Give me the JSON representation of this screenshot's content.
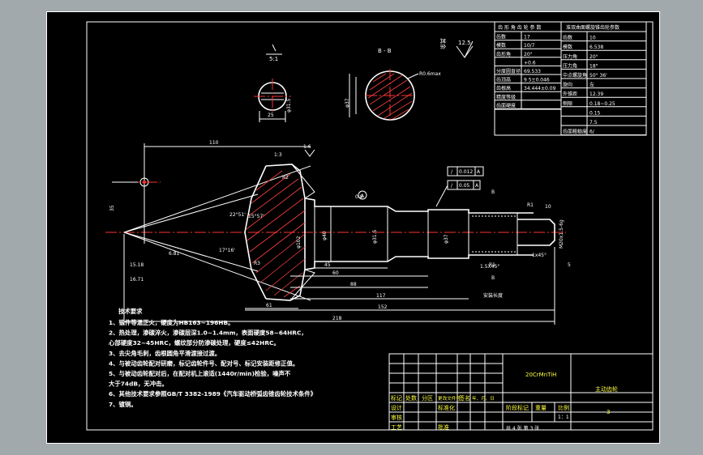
{
  "part_name": "主动齿轮",
  "material": "20CrMnTiH",
  "drawing_number": "3",
  "scale": "1：1",
  "sheet_info": "共 4 张 第 3 张",
  "surface_finish": {
    "prefix": "其余",
    "value": "12.5"
  },
  "section_label": "B - B",
  "param_table_left": {
    "title": "齿 形 角 齿 轮 参 数",
    "rows": [
      [
        "齿数",
        "17"
      ],
      [
        "模数",
        "10/7"
      ],
      [
        "齿形角",
        "20°"
      ],
      [
        "",
        "+0.6"
      ],
      [
        "分度圆直径",
        "69.533"
      ],
      [
        "齿顶高",
        "9  5±0.046"
      ],
      [
        "齿根高",
        "34.444±0.09"
      ],
      [
        "精度等级",
        ""
      ],
      [
        "齿面硬度",
        ""
      ]
    ]
  },
  "param_table_right": {
    "title": "准双曲面螺旋锥齿轮参数",
    "rows": [
      [
        "齿数",
        "10"
      ],
      [
        "模数",
        "6.538"
      ],
      [
        "压力角",
        "20°"
      ],
      [
        "压力角",
        "18°"
      ],
      [
        "中点螺旋角",
        "50° 36'"
      ],
      [
        "旋向",
        "左"
      ],
      [
        "外锥距",
        "12.39"
      ],
      [
        "侧隙",
        "0.18~0.25"
      ],
      [
        "",
        "0.15"
      ],
      [
        "",
        "7.5"
      ],
      [
        "齿面粗糙度",
        "6/"
      ]
    ]
  },
  "dimensions": {
    "d_110": "110",
    "d_1_3": "1:3",
    "d_5_1": "5:1",
    "d_25": "25",
    "d_31_5": "φ31.5",
    "d_t37": "φ37",
    "d_06max": "R0.6max",
    "d_r2": "R2",
    "d_r3": "R3",
    "d_r1": "R1",
    "d_r1_2": "R1",
    "d_ang1": "22°51'",
    "d_ang2": "15°57'",
    "d_ang3": "17°16'",
    "d_35": "35",
    "d_15_18": "15.18",
    "d_16_71": "16.71",
    "d_6_81": "6.81",
    "d_0_8": "0.8",
    "d_a_ref": "A",
    "d_phi40": "φ40",
    "d_phi31_5": "φ31.5",
    "d_phi37": "φ37",
    "d_phi102": "φ102",
    "d_45": "45",
    "d_60": "60",
    "d_88": "88",
    "d_117": "117",
    "d_61": "61",
    "d_152": "152",
    "d_218": "218",
    "d_10": "10",
    "d_5": "5",
    "d_1_5x45": "1.5X45°",
    "d_1x45": "1x45°",
    "d_m20": "M20x1.5-6g",
    "d_b1": "B",
    "d_b2": "B",
    "d_thread_len": "安装长度",
    "tol1_sym": "/",
    "tol1_val": "0.012",
    "tol1_ref": "A",
    "tol2_sym": "/",
    "tol2_val": "0.05",
    "tol2_ref": "A",
    "d_1_6": "1.6"
  },
  "notes": {
    "title": "技术要求",
    "lines": [
      "1、锻件等温正火，硬度为HB163~196HB。",
      "2、热处理，渗碳淬火，渗碳层深1.0~1.4mm，表面硬度58~64HRC，",
      "   心部硬度32~45HRC，螺纹部分防渗碳处理，硬度≤42HRC。",
      "3、去尖角毛刺，齿根圆角平滑渡接过渡。",
      "4、与被动齿轮配对研磨，标记齿轮件号、配对号、标记安装距修正值。",
      "5、与被动齿轮配对后，在配对机上滚适(1440r/min)检验，噪声不",
      "   大于74dB，无冲击。",
      "6、其他技术要求参照GB/T 3382-1989《汽车驱动桥弧齿锥齿轮技术条件》",
      "7、镀铜。"
    ]
  },
  "title_block": {
    "labels": [
      "标记",
      "处数",
      "分区",
      "更改文件号",
      "签名",
      "年、月、日"
    ],
    "row2": [
      "设计",
      "",
      "标准化",
      "",
      "阶段标记",
      "重量",
      "比例"
    ],
    "row3": [
      "审核",
      ""
    ],
    "row4": [
      "工艺",
      "",
      "批准"
    ]
  }
}
